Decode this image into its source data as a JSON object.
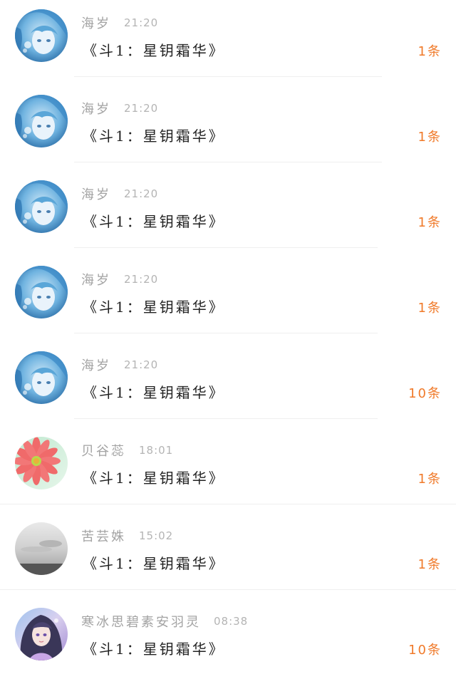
{
  "messages": [
    {
      "name": "海岁",
      "time": "21:20",
      "title": "《斗1：星钥霜华》",
      "count": "1条",
      "avatar": "blue-anime-girl"
    },
    {
      "name": "海岁",
      "time": "21:20",
      "title": "《斗1：星钥霜华》",
      "count": "1条",
      "avatar": "blue-anime-girl"
    },
    {
      "name": "海岁",
      "time": "21:20",
      "title": "《斗1：星钥霜华》",
      "count": "1条",
      "avatar": "blue-anime-girl"
    },
    {
      "name": "海岁",
      "time": "21:20",
      "title": "《斗1：星钥霜华》",
      "count": "1条",
      "avatar": "blue-anime-girl"
    },
    {
      "name": "海岁",
      "time": "21:20",
      "title": "《斗1：星钥霜华》",
      "count": "10条",
      "avatar": "blue-anime-girl"
    },
    {
      "name": "贝谷蕊",
      "time": "18:01",
      "title": "《斗1：星钥霜华》",
      "count": "1条",
      "avatar": "pink-flower"
    },
    {
      "name": "苦芸姝",
      "time": "15:02",
      "title": "《斗1：星钥霜华》",
      "count": "1条",
      "avatar": "grey-sky"
    },
    {
      "name": "寒冰思碧素安羽灵",
      "time": "08:38",
      "title": "《斗1：星钥霜华》",
      "count": "10条",
      "avatar": "purple-anime-girl"
    }
  ]
}
